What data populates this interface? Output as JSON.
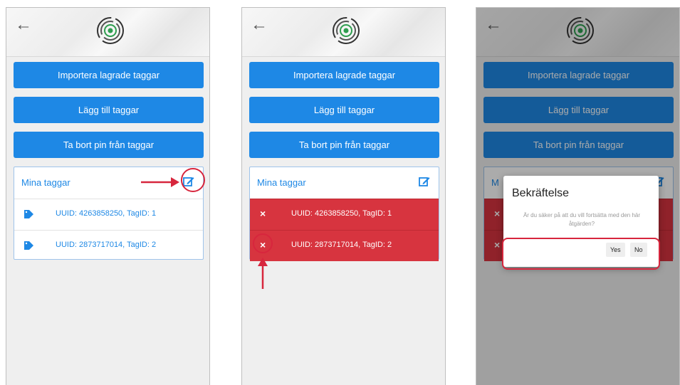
{
  "screens": [
    {
      "buttons": [
        "Importera lagrade taggar",
        "Lägg till taggar",
        "Ta bort pin från taggar"
      ],
      "card_title": "Mina taggar",
      "rows": [
        "UUID: 4263858250, TagID: 1",
        "UUID: 2873717014, TagID: 2"
      ]
    },
    {
      "buttons": [
        "Importera lagrade taggar",
        "Lägg till taggar",
        "Ta bort pin från taggar"
      ],
      "card_title": "Mina taggar",
      "rows": [
        "UUID: 4263858250, TagID: 1",
        "UUID: 2873717014, TagID: 2"
      ],
      "delete_glyph": "×"
    },
    {
      "buttons": [
        "Importera lagrade taggar",
        "Lägg till taggar",
        "Ta bort pin från taggar"
      ],
      "card_title": "M",
      "delete_glyph": "×",
      "dialog": {
        "title": "Bekräftelse",
        "message": "Är du säker på att du vill fortsätta med den här åtgärden?",
        "yes": "Yes",
        "no": "No"
      }
    }
  ],
  "icons": {
    "back": "←",
    "logo": "fingerprint-logo-icon",
    "edit": "edit-icon",
    "tag": "tag-icon"
  },
  "colors": {
    "primary": "#1e88e5",
    "danger": "#d7343f",
    "annotation": "#d7263d"
  }
}
